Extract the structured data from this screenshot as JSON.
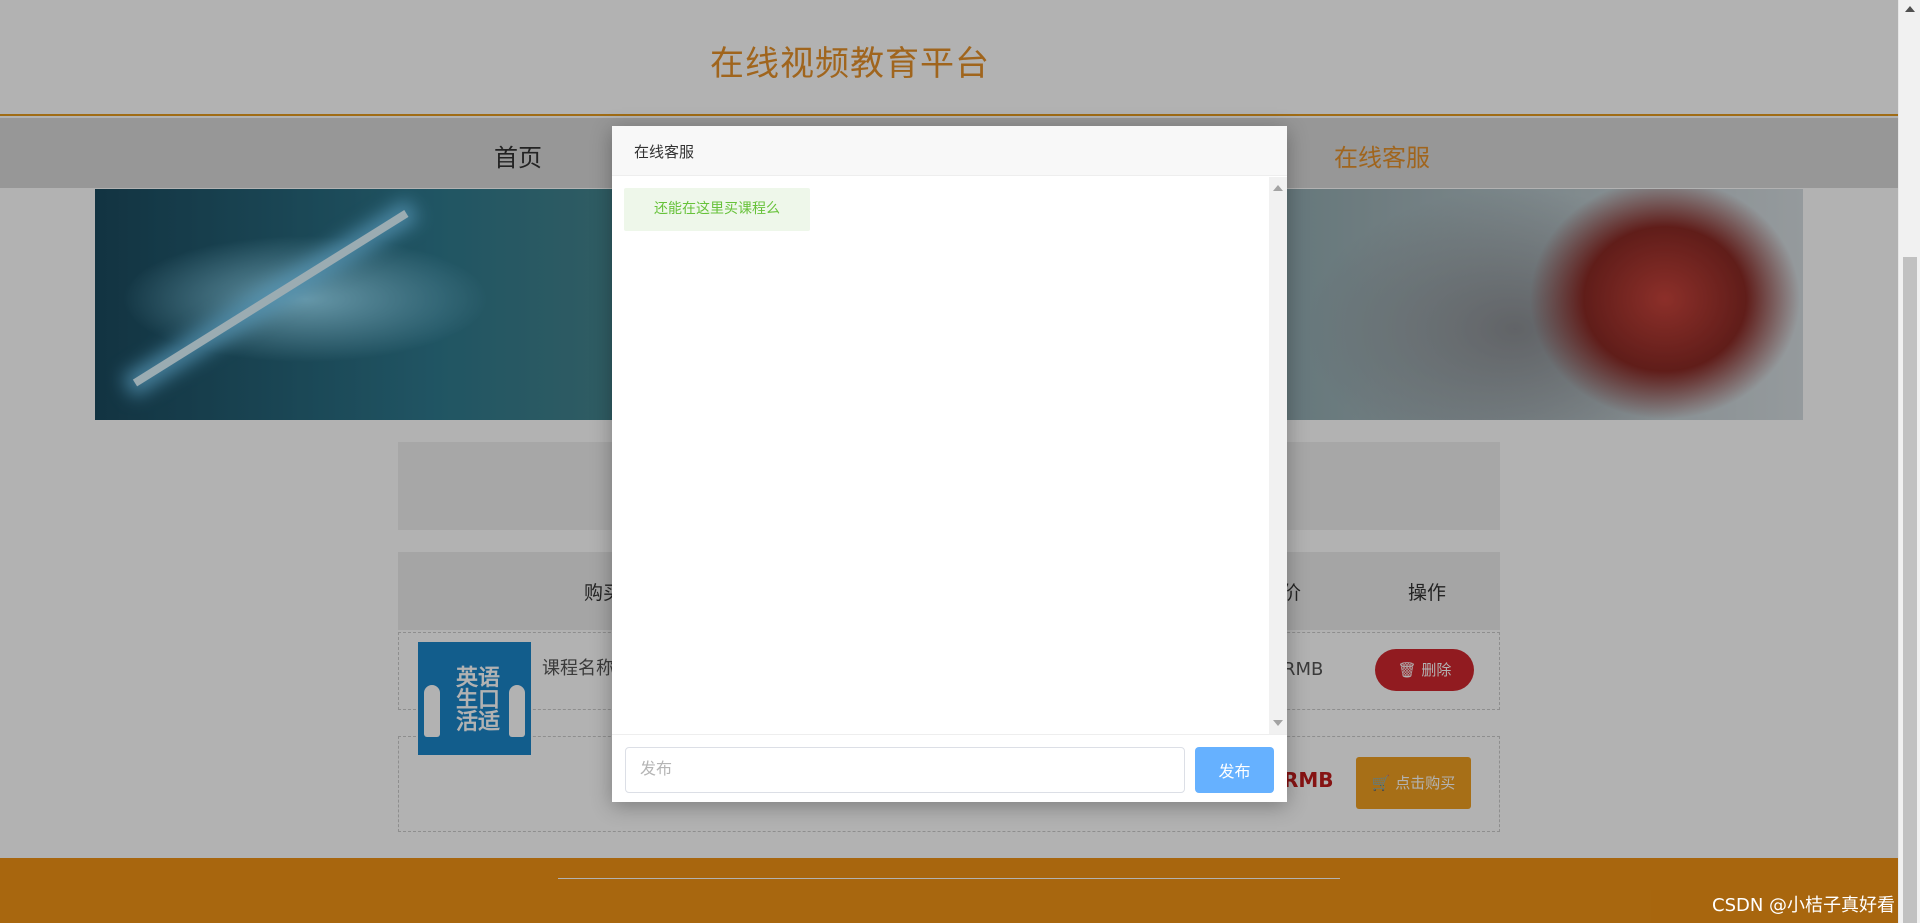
{
  "site": {
    "title": "在线视频教育平台"
  },
  "nav": {
    "home": "首页",
    "service": "在线客服"
  },
  "cart": {
    "header_buy": "购买",
    "header_price_fragment": "价",
    "header_action": "操作",
    "rows": [
      {
        "course_name_prefix": "课程名称",
        "price": "RMB",
        "action_label": "删除"
      },
      {
        "price": "RMB",
        "action_label": "点击购买"
      }
    ]
  },
  "thumb": {
    "text": "英语生口活适"
  },
  "modal": {
    "title": "在线客服",
    "messages": [
      {
        "text": "还能在这里买课程么"
      }
    ],
    "input_placeholder": "发布",
    "send_label": "发布"
  },
  "watermark": "CSDN @小桔子真好看",
  "colors": {
    "brand_orange": "#e6912a",
    "footer_orange": "#f19315",
    "delete_red": "#d0282e",
    "send_blue": "#66b1ff",
    "message_green": "#67c23a"
  },
  "icons": {
    "delete": "trash-icon",
    "buy": "cart-icon"
  }
}
